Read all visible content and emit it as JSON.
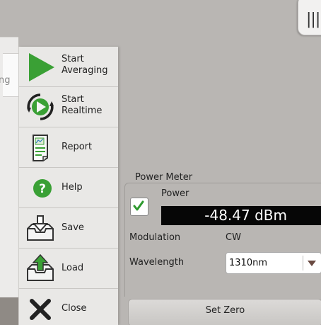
{
  "colors": {
    "background": "#b9b6b3",
    "menu_background": "#e9e8e6",
    "accent_green": "#3aa035",
    "readout_background": "#060606"
  },
  "left_strip": {
    "partial_text": "ng"
  },
  "top_tab": {
    "icon": "bars-icon",
    "glyph": "|||"
  },
  "menu": {
    "items": [
      {
        "label_line1": "Start",
        "label_line2": "Averaging",
        "icon": "play-icon"
      },
      {
        "label_line1": "Start",
        "label_line2": "Realtime",
        "icon": "realtime-icon"
      },
      {
        "label": "Report",
        "icon": "report-icon"
      },
      {
        "label": "Help",
        "icon": "help-icon"
      },
      {
        "label": "Save",
        "icon": "save-icon"
      },
      {
        "label": "Load",
        "icon": "load-icon"
      },
      {
        "label": "Close",
        "icon": "close-icon"
      }
    ]
  },
  "power_meter": {
    "title": "Power Meter",
    "power_label": "Power",
    "power_enabled": true,
    "reading": "-48.47 dBm",
    "modulation_label": "Modulation",
    "modulation_value": "CW",
    "wavelength_label": "Wavelength",
    "wavelength_value": "1310nm",
    "set_zero_label": "Set Zero"
  }
}
